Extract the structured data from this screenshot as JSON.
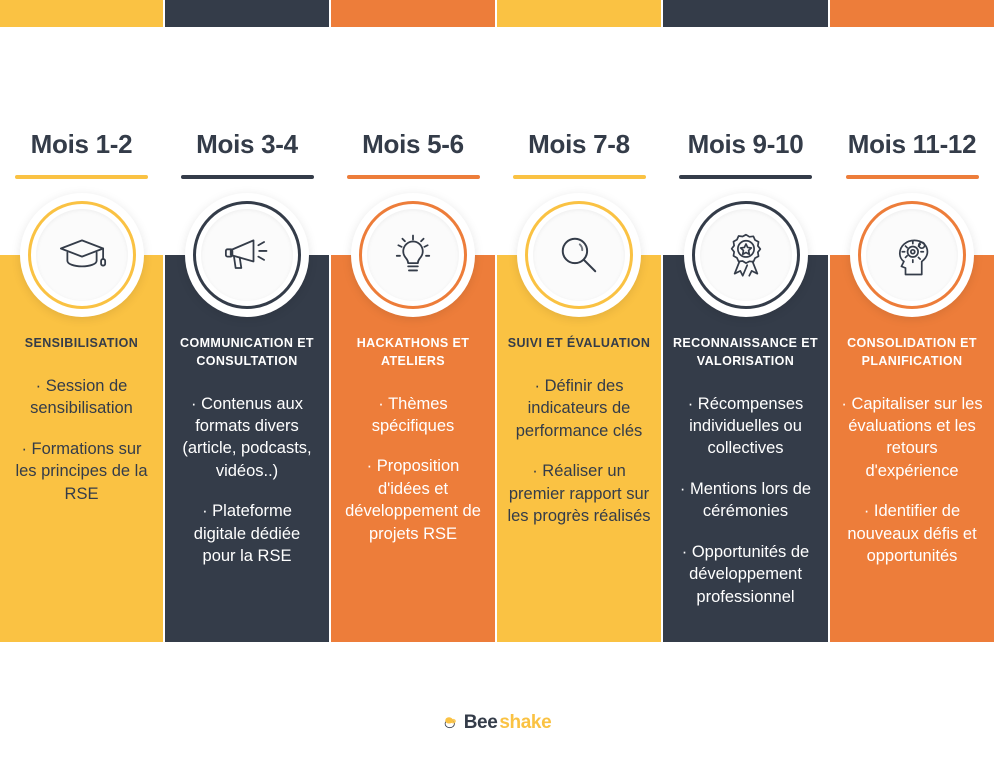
{
  "theme": {
    "yellow": "#FAC243",
    "dark": "#343C49",
    "orange": "#ED7D3A",
    "white": "#FFFFFF"
  },
  "columns": [
    {
      "month": "Mois 1-2",
      "color": "#FAC243",
      "text_color": "#343C49",
      "icon": "graduation-cap-icon",
      "title": "SENSIBILISATION",
      "bullets": [
        "· Session de sensibilisation",
        "· Formations sur les principes de la RSE"
      ]
    },
    {
      "month": "Mois 3-4",
      "color": "#343C49",
      "text_color": "#FFFFFF",
      "icon": "megaphone-icon",
      "title": "COMMUNICATION ET CONSULTATION",
      "bullets": [
        "· Contenus aux formats divers (article, podcasts, vidéos..)",
        "· Plateforme digitale dédiée pour la RSE"
      ]
    },
    {
      "month": "Mois 5-6",
      "color": "#ED7D3A",
      "text_color": "#FFFFFF",
      "icon": "lightbulb-icon",
      "title": "HACKATHONS ET ATELIERS",
      "bullets": [
        "· Thèmes spécifiques",
        "· Proposition d'idées et développement de projets RSE"
      ]
    },
    {
      "month": "Mois 7-8",
      "color": "#FAC243",
      "text_color": "#343C49",
      "icon": "magnifier-icon",
      "title": "SUIVI ET ÉVALUATION",
      "bullets": [
        "· Définir des indicateurs de performance clés",
        "· Réaliser un premier rapport sur les progrès réalisés"
      ]
    },
    {
      "month": "Mois 9-10",
      "color": "#343C49",
      "text_color": "#FFFFFF",
      "icon": "award-ribbon-icon",
      "title": "RECONNAISSANCE ET VALORISATION",
      "bullets": [
        "· Récompenses individuelles ou collectives",
        "· Mentions lors de cérémonies",
        "· Opportunités de développement professionnel"
      ]
    },
    {
      "month": "Mois 11-12",
      "color": "#ED7D3A",
      "text_color": "#FFFFFF",
      "icon": "head-gears-icon",
      "title": "CONSOLIDATION ET PLANIFICATION",
      "bullets": [
        "· Capitaliser sur les évaluations et les retours d'expérience",
        "· Identifier de nouveaux défis et opportunités"
      ]
    }
  ],
  "footer": {
    "logo_mark": "bee-icon",
    "logo_part1": "Bee",
    "logo_part2": "shake"
  }
}
